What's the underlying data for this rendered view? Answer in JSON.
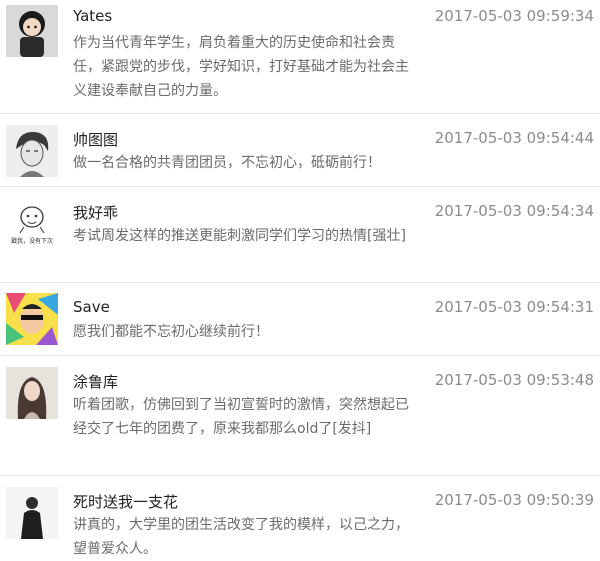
{
  "comments": [
    {
      "name": "Yates",
      "time": "2017-05-03 09:59:34",
      "text": "作为当代青年学生，肩负着重大的历史使命和社会责任，紧跟党的步伐，学好知识，打好基础才能为社会主义建设奉献自己的力量。",
      "avatar": "avatar-cartoon-boy"
    },
    {
      "name": "帅图图",
      "time": "2017-05-03 09:54:44",
      "text": "做一名合格的共青团团员，不忘初心，砥砺前行！",
      "avatar": "avatar-sketch-portrait"
    },
    {
      "name": "我好乖",
      "time": "2017-05-03 09:54:34",
      "text": "考试周发这样的推送更能刺激同学们学习的热情[强壮]",
      "avatar": "avatar-doodle",
      "avatar_caption": "戳我，没有下次"
    },
    {
      "name": "Save",
      "time": "2017-05-03 09:54:31",
      "text": "愿我们都能不忘初心继续前行！",
      "avatar": "avatar-colorful-art"
    },
    {
      "name": "涂鲁库",
      "time": "2017-05-03 09:53:48",
      "text": "听着团歌，仿佛回到了当初宣誓时的激情，突然想起已经交了七年的团费了，原来我都那么old了[发抖]",
      "avatar": "avatar-girl-photo"
    },
    {
      "name": "死时送我一支花",
      "time": "2017-05-03 09:50:39",
      "text": "讲真的，大学里的团生活改变了我的模样，以己之力，望普爱众人。",
      "avatar": "avatar-person-photo"
    }
  ]
}
